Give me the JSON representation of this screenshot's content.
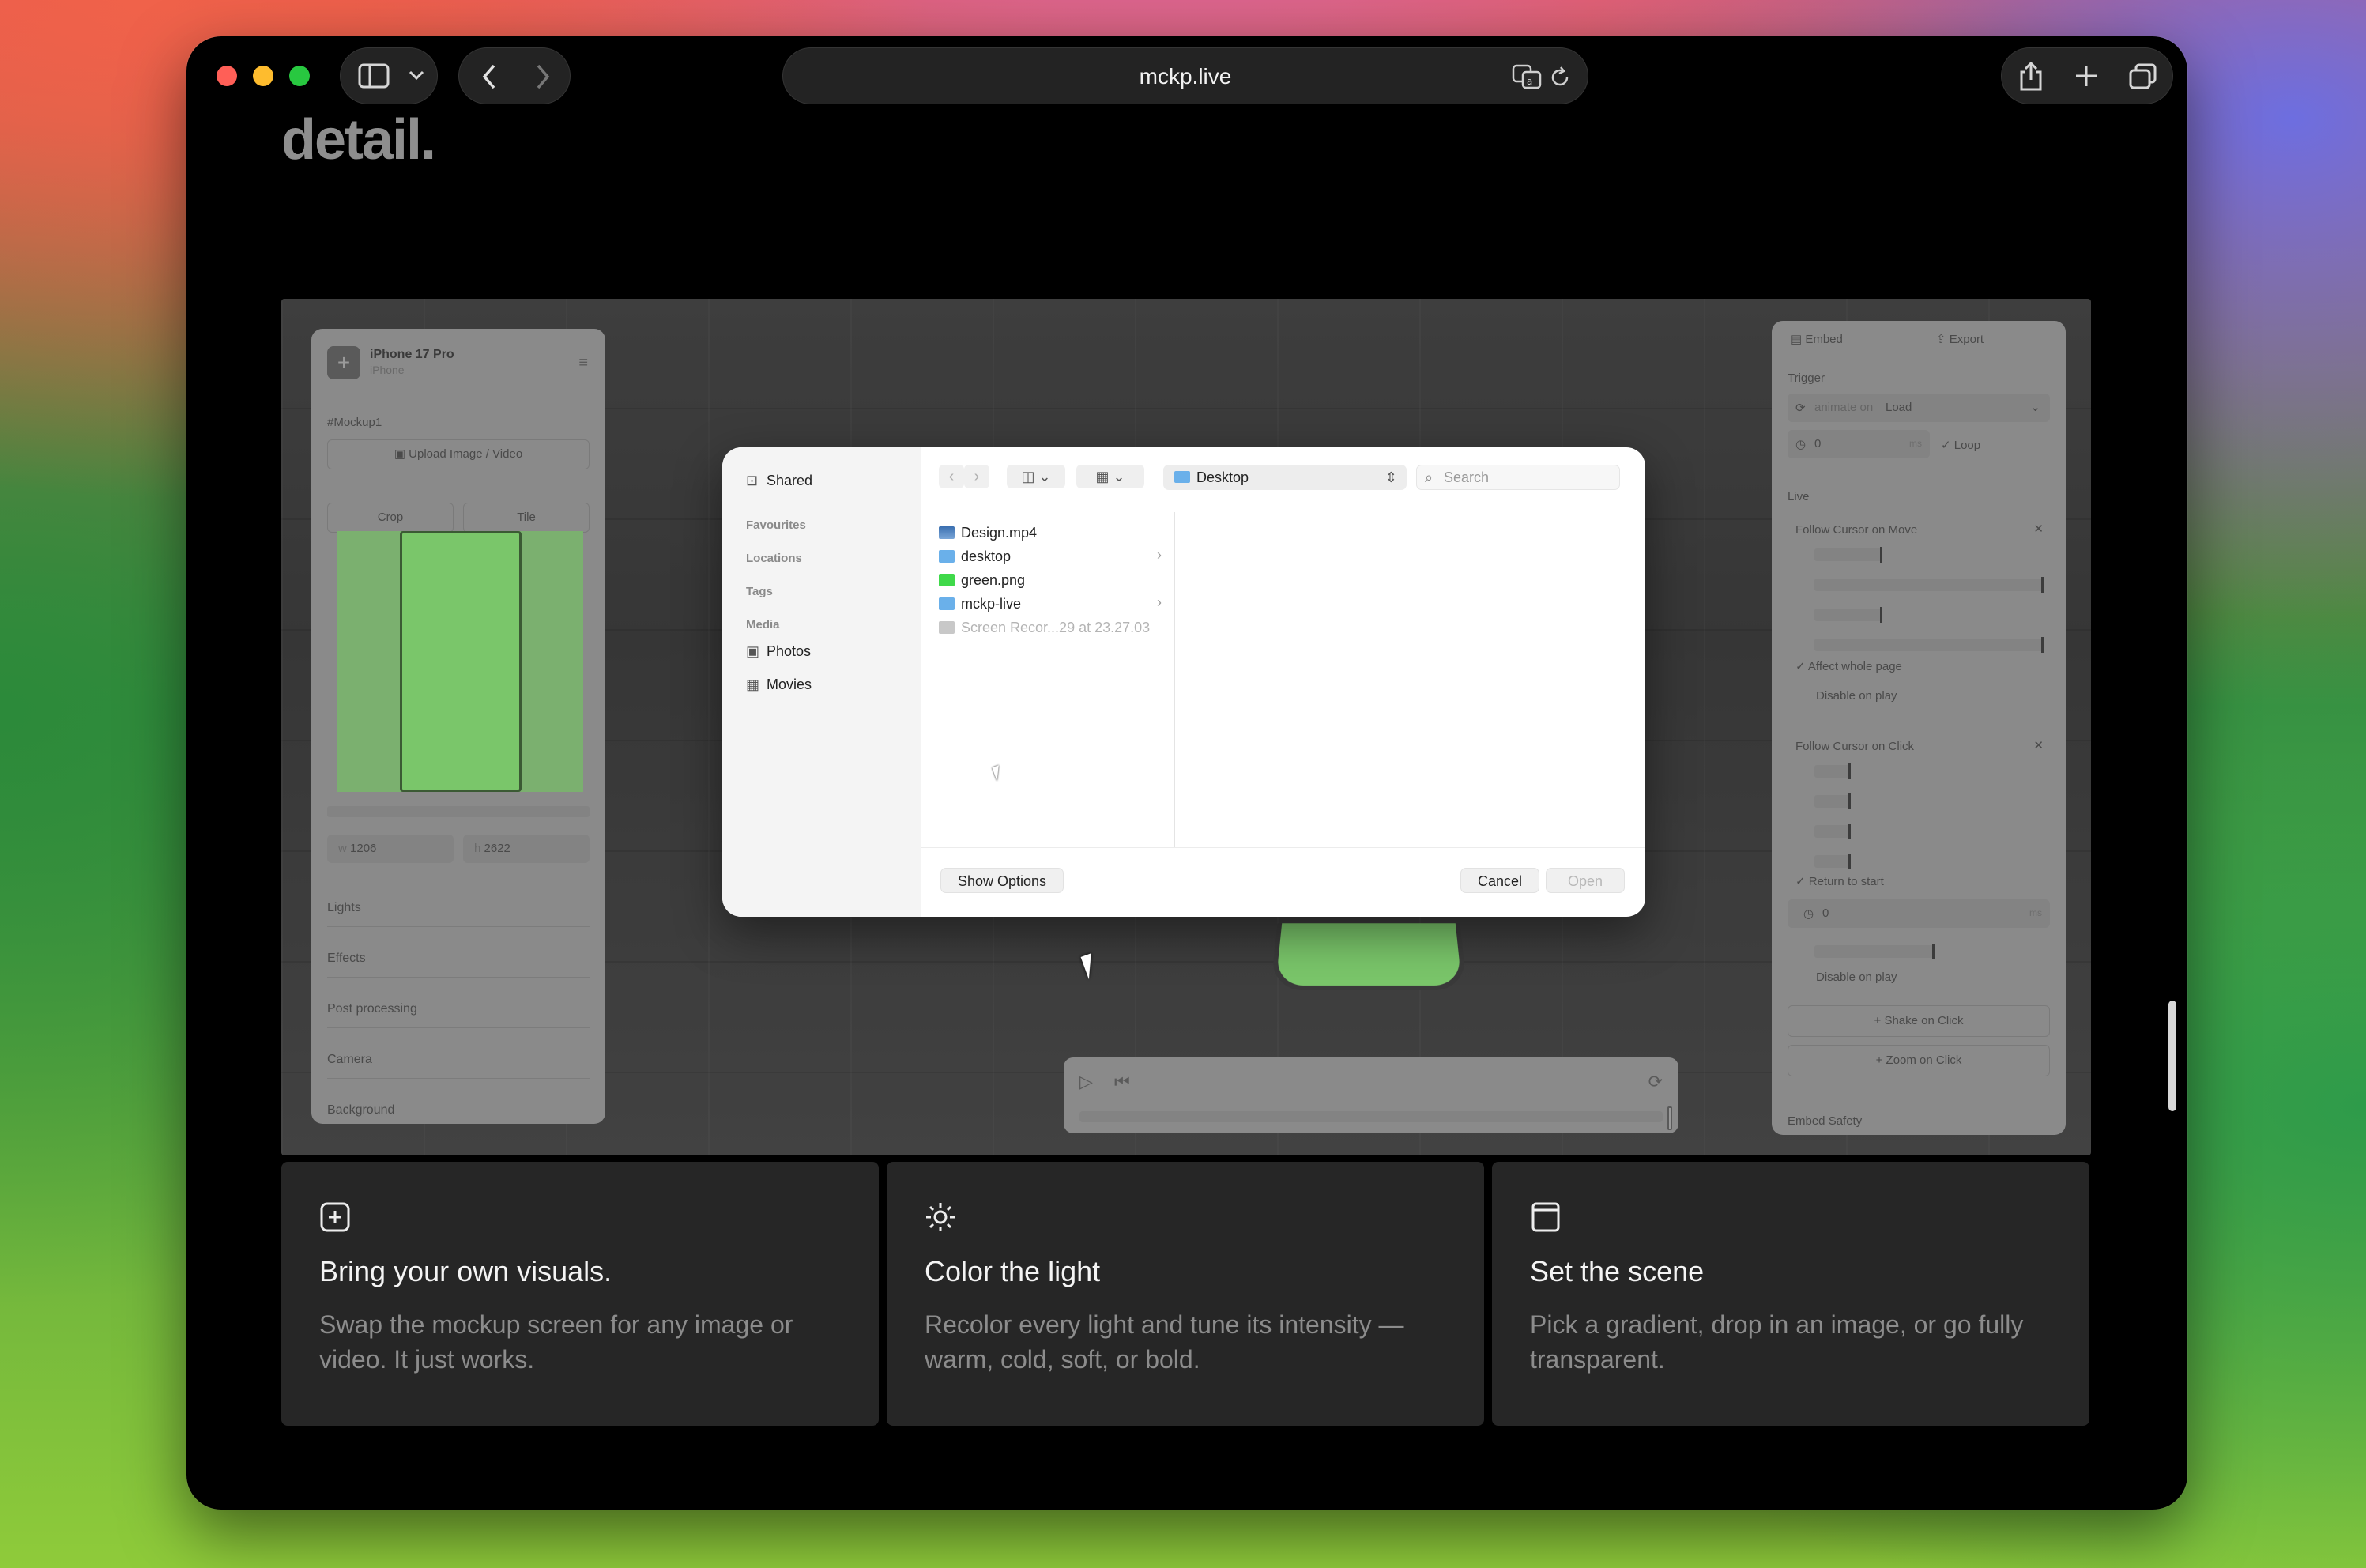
{
  "browser": {
    "url": "mckp.live"
  },
  "page": {
    "headline_fragment": "detail."
  },
  "left_panel": {
    "device_title": "iPhone 17 Pro",
    "device_subtitle": "iPhone",
    "mockup_label": "#Mockup1",
    "upload_button": "Upload Image / Video",
    "crop_label": "Crop",
    "tile_label": "Tile",
    "width_prefix": "w",
    "width_value": "1206",
    "height_prefix": "h",
    "height_value": "2622",
    "sections": [
      "Lights",
      "Effects",
      "Post processing",
      "Camera",
      "Background"
    ]
  },
  "right_panel": {
    "embed_tab": "Embed",
    "export_tab": "Export",
    "trigger_label": "Trigger",
    "trigger_value_prefix": "animate on",
    "trigger_value": "Load",
    "delay_value": "0",
    "delay_unit": "ms",
    "loop_label": "Loop",
    "live_label": "Live",
    "follow_move_label": "Follow Cursor on Move",
    "affect_whole_page": "Affect whole page",
    "disable_on_play_1": "Disable on play",
    "follow_click_label": "Follow Cursor on Click",
    "return_to_start": "Return to start",
    "click_delay_value": "0",
    "click_delay_unit": "ms",
    "disable_on_play_2": "Disable on play",
    "shake_on_click": "Shake on Click",
    "zoom_on_click": "Zoom on Click",
    "embed_safety": "Embed Safety"
  },
  "file_dialog": {
    "sidebar": {
      "shared": "Shared",
      "favourites": "Favourites",
      "locations": "Locations",
      "tags": "Tags",
      "media": "Media",
      "photos": "Photos",
      "movies": "Movies"
    },
    "location": "Desktop",
    "search_placeholder": "Search",
    "files": [
      {
        "name": "Design.mp4",
        "kind": "video"
      },
      {
        "name": "desktop",
        "kind": "folder"
      },
      {
        "name": "green.png",
        "kind": "image"
      },
      {
        "name": "mckp-live",
        "kind": "folder"
      },
      {
        "name": "Screen Recor...29 at 23.27.03",
        "kind": "video-disabled"
      }
    ],
    "show_options": "Show Options",
    "cancel": "Cancel",
    "open": "Open"
  },
  "features": [
    {
      "icon": "plus-square-icon",
      "title": "Bring your own visuals.",
      "body": "Swap the mockup screen for any image or video. It just works."
    },
    {
      "icon": "sun-icon",
      "title": "Color the light",
      "body": "Recolor every light and tune its intensity — warm, cold, soft, or bold."
    },
    {
      "icon": "frame-icon",
      "title": "Set the scene",
      "body": "Pick a gradient, drop in an image, or go fully transparent."
    }
  ],
  "colors": {
    "accent_green": "#7ac66a",
    "folder_blue": "#6ab0ea"
  }
}
